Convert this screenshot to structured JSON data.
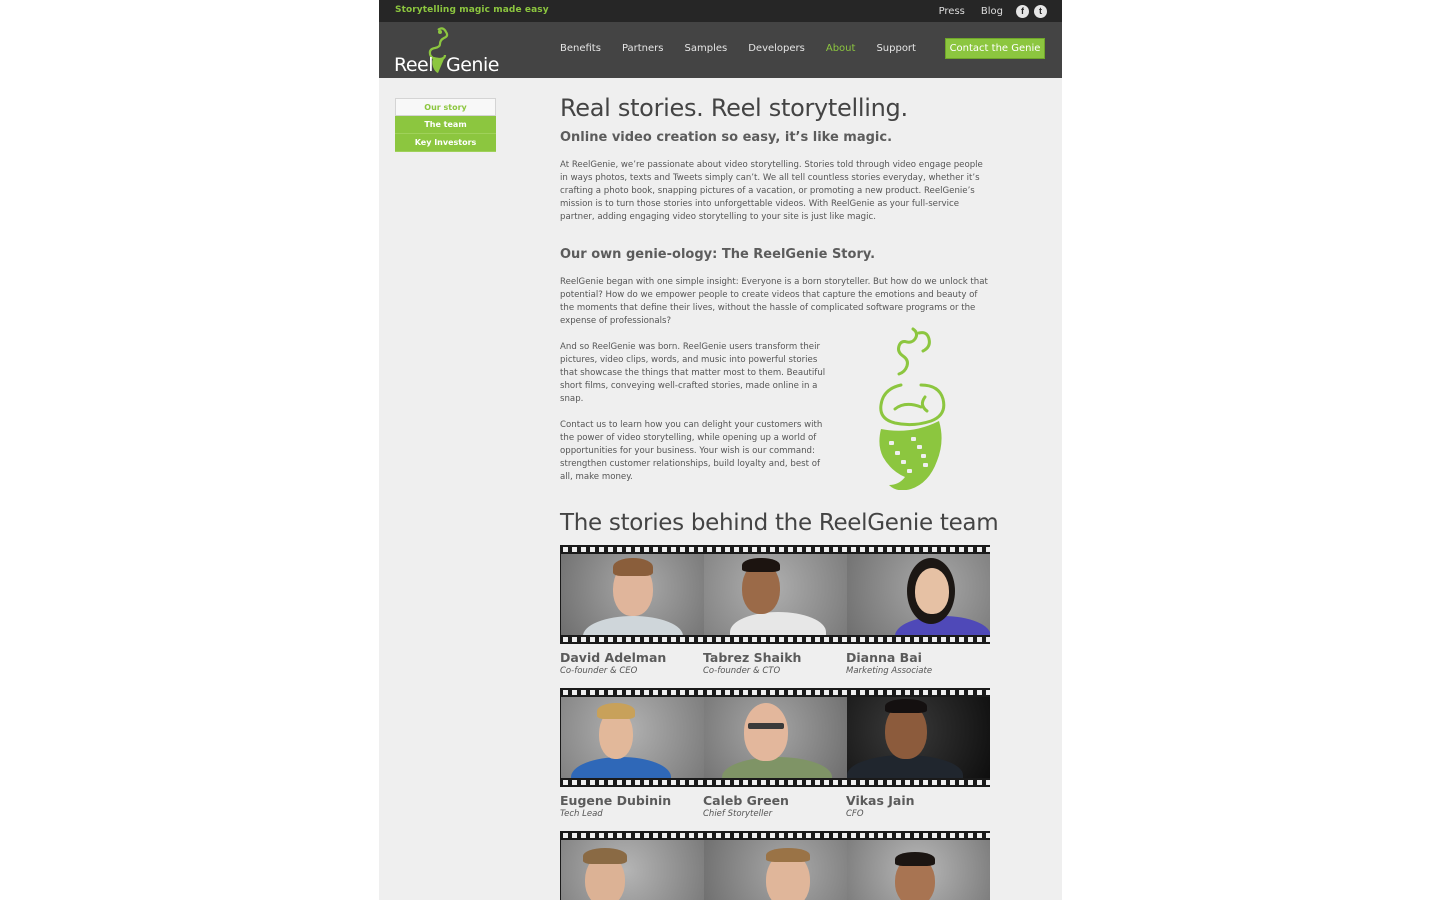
{
  "topbar": {
    "tagline": "Storytelling magic made easy",
    "links": [
      "Press",
      "Blog"
    ],
    "social": [
      {
        "name": "facebook",
        "glyph": "f"
      },
      {
        "name": "twitter",
        "glyph": "t"
      }
    ]
  },
  "header": {
    "logo_left": "Reel",
    "logo_right": "Genie",
    "nav": [
      "Benefits",
      "Partners",
      "Samples",
      "Developers",
      "About",
      "Support"
    ],
    "active_nav": "About",
    "cta": "Contact the Genie"
  },
  "subnav": [
    "Our story",
    "The team",
    "Key Investors"
  ],
  "content": {
    "title": "Real stories. Reel storytelling.",
    "subtitle": "Online video creation so easy, it’s like magic.",
    "intro": "At ReelGenie, we’re passionate about video storytelling. Stories told through video engage people in ways photos, texts and Tweets simply can’t. We all tell countless stories everyday, whether it’s crafting a photo book, snapping pictures of a vacation, or promoting a new product. ReelGenie’s mission is to turn those stories into unforgettable videos. With ReelGenie as your full-service partner, adding engaging video storytelling to your site is just like magic.",
    "story_heading": "Our own genie-ology: The ReelGenie Story.",
    "story_p1": "ReelGenie began with one simple insight: Everyone is a born storyteller. But how do we unlock that potential? How do we empower people to create videos that capture the emotions and beauty of the moments that define their lives, without the hassle of complicated software programs or the expense of professionals?",
    "story_p2": "And so ReelGenie was born. ReelGenie users transform their pictures, video clips, words, and music into powerful stories that showcase the things that matter most to them. Beautiful short films, conveying well-crafted stories, made online in a snap.",
    "story_p3": "Contact us to learn how you can delight your customers with the power of video storytelling, while opening up a world of opportunities for your business. Your wish is our command: strengthen customer relationships, build loyalty and, best of all, make money.",
    "team_heading": "The stories behind the ReelGenie team"
  },
  "team": [
    {
      "name": "David Adelman",
      "role": "Co-founder & CEO"
    },
    {
      "name": "Tabrez Shaikh",
      "role": "Co-founder & CTO"
    },
    {
      "name": "Dianna Bai",
      "role": "Marketing Associate"
    },
    {
      "name": "Eugene Dubinin",
      "role": "Tech Lead"
    },
    {
      "name": "Caleb Green",
      "role": "Chief Storyteller"
    },
    {
      "name": "Vikas Jain",
      "role": "CFO"
    }
  ],
  "colors": {
    "brand_green": "#8cc63f",
    "header_bg": "#444444",
    "topbar_bg": "#262626",
    "page_bg": "#efefef"
  }
}
